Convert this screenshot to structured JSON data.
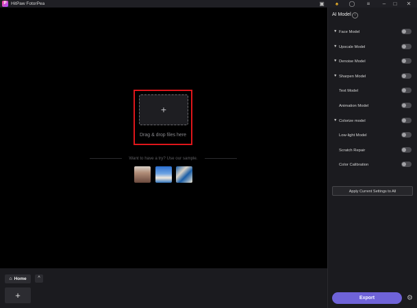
{
  "app": {
    "title": "HitPaw FotorPea",
    "logo_letter": "P"
  },
  "titlebar_icons": [
    "gamepad-icon",
    "gift-icon",
    "user-icon",
    "menu-icon",
    "minimize-icon",
    "maximize-icon",
    "close-icon"
  ],
  "canvas": {
    "drop_plus": "+",
    "drop_text": "Drag & drop files here",
    "sample_text": "Want to have a try? Use our sample."
  },
  "bottom": {
    "home_label": "Home",
    "collapse": "^",
    "add": "+"
  },
  "panel": {
    "title": "AI Model",
    "models": [
      {
        "label": "Face Model",
        "has_caret": true,
        "enabled": false
      },
      {
        "label": "Upscale Model",
        "has_caret": true,
        "enabled": false
      },
      {
        "label": "Denoise Model",
        "has_caret": true,
        "enabled": false
      },
      {
        "label": "Sharpen Model",
        "has_caret": true,
        "enabled": false
      },
      {
        "label": "Text Model",
        "has_caret": false,
        "enabled": false
      },
      {
        "label": "Animation Model",
        "has_caret": false,
        "enabled": false
      },
      {
        "label": "Colorize model",
        "has_caret": true,
        "enabled": false
      },
      {
        "label": "Low-light Model",
        "has_caret": false,
        "enabled": false
      },
      {
        "label": "Scratch Repair",
        "has_caret": false,
        "enabled": false
      },
      {
        "label": "Color Calibration",
        "has_caret": false,
        "enabled": false
      }
    ],
    "apply_label": "Apply Current Settings to All",
    "export_label": "Export"
  },
  "colors": {
    "accent": "#6f63d8",
    "highlight_border": "#e0161b",
    "panel_bg": "#1b1b1f"
  }
}
